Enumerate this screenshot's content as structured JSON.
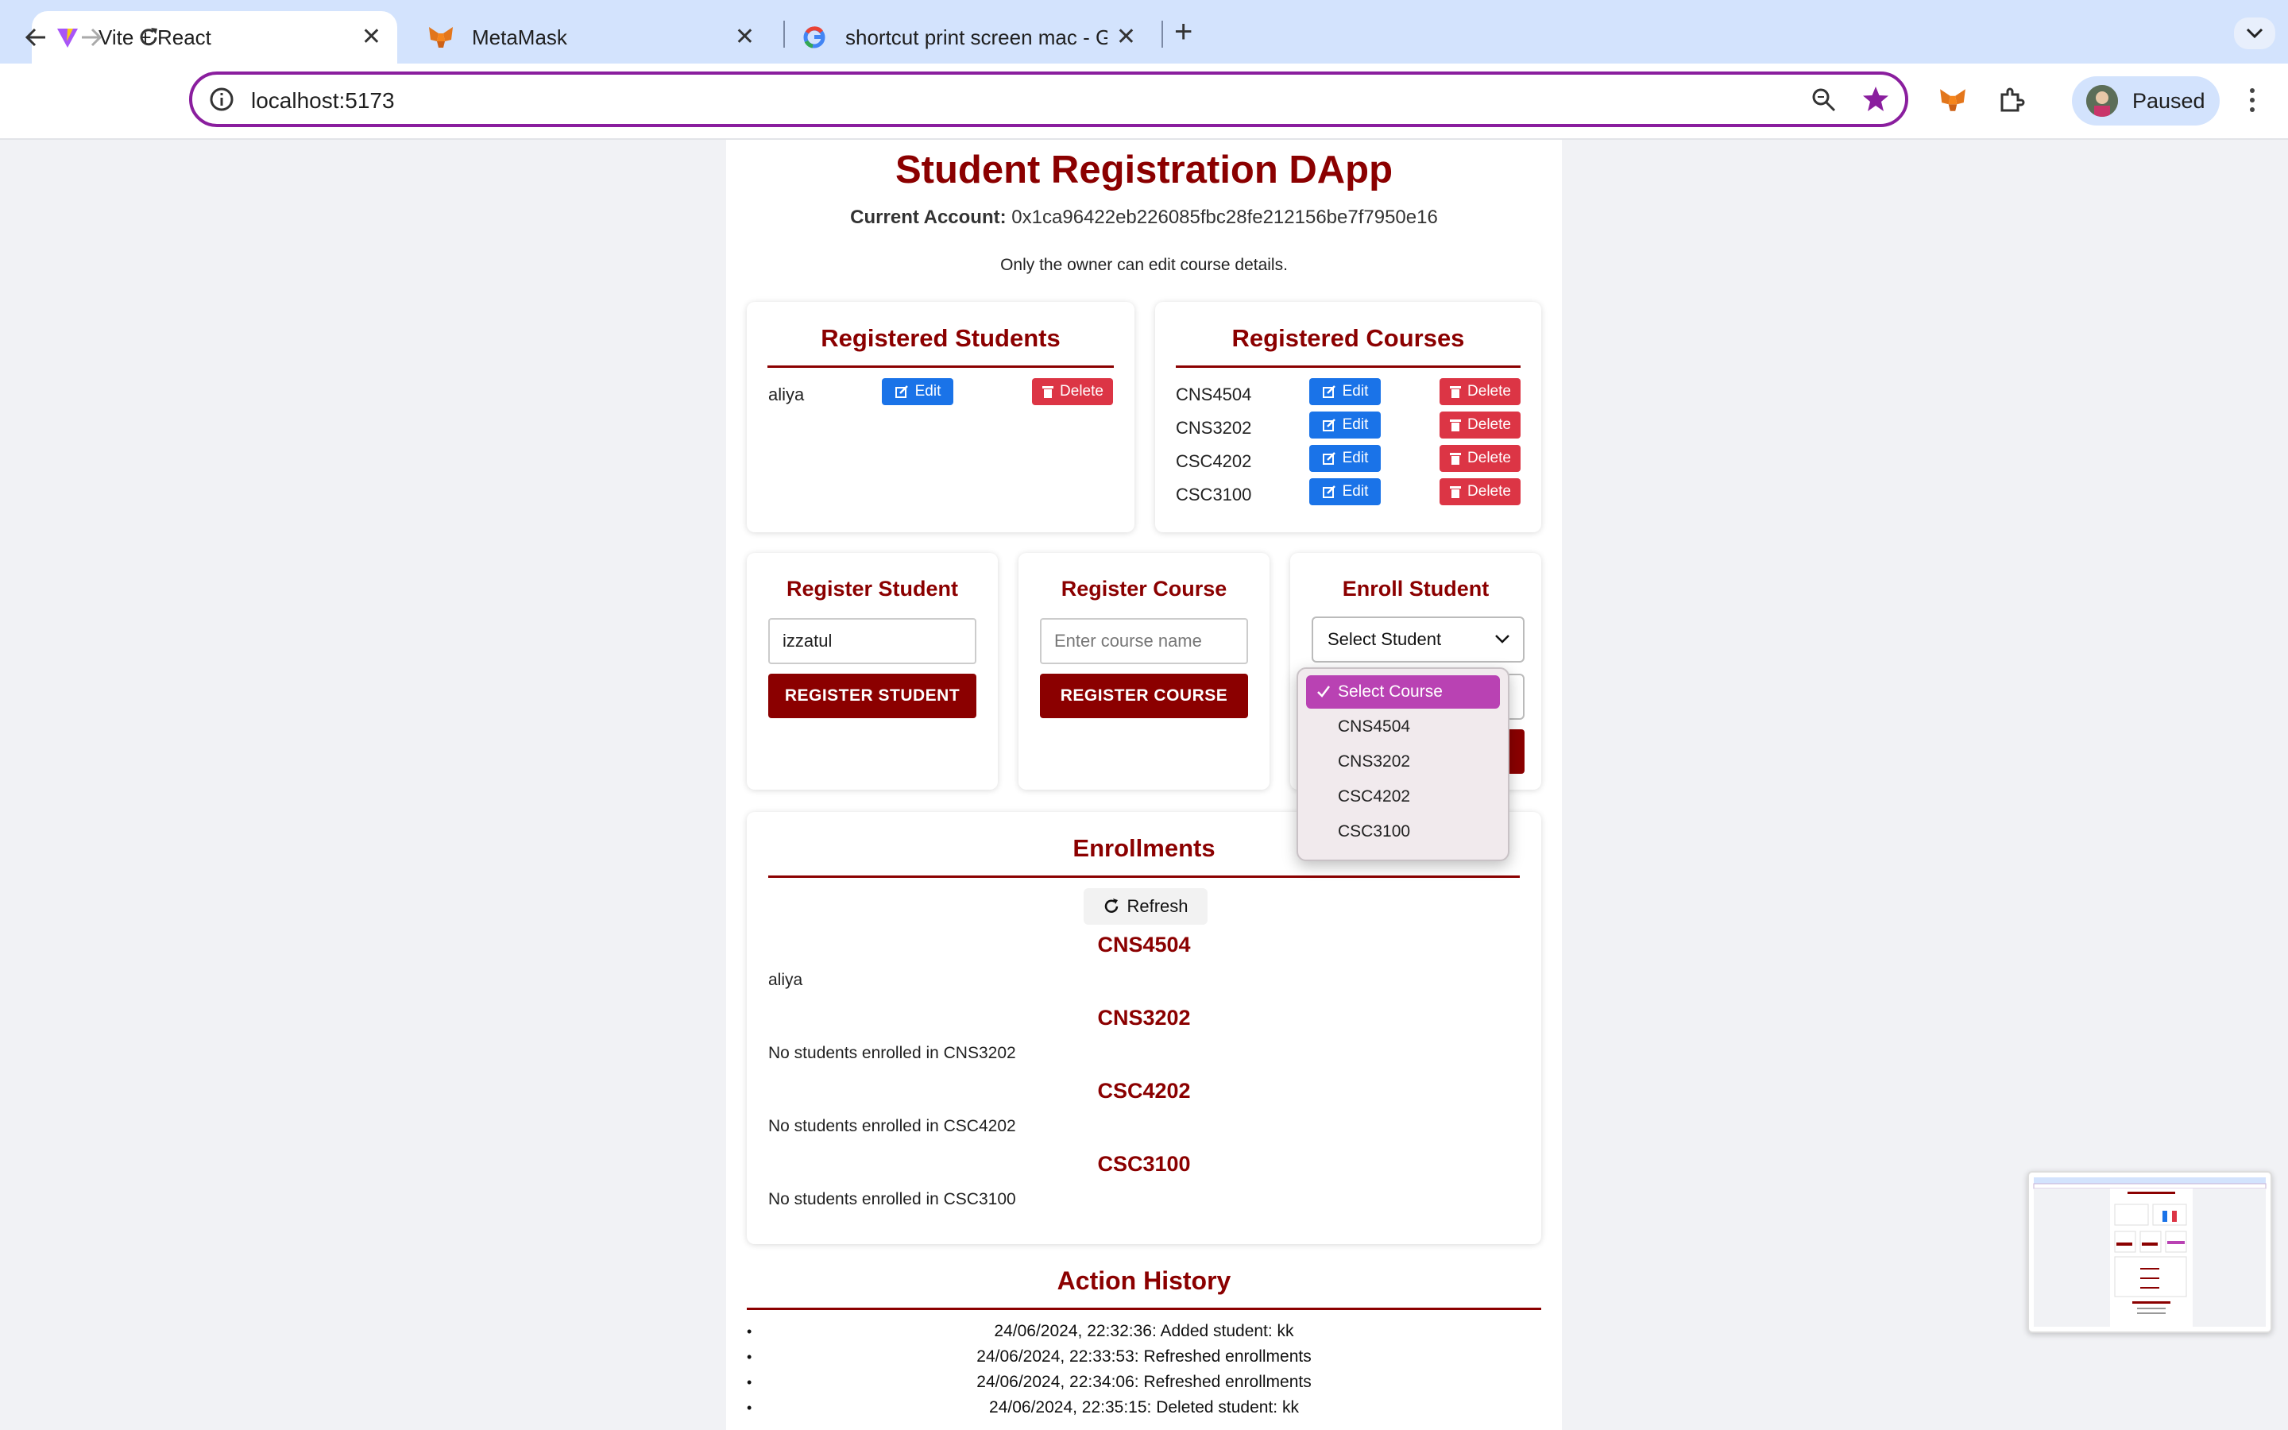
{
  "browser": {
    "tabs": [
      {
        "title": "Vite + React",
        "icon": "vite-icon",
        "active": true
      },
      {
        "title": "MetaMask",
        "icon": "metamask-fox-icon",
        "active": false
      },
      {
        "title": "shortcut print screen mac - G",
        "icon": "google-g-icon",
        "active": false
      }
    ],
    "url": "localhost:5173",
    "profile_label": "Paused"
  },
  "app": {
    "title": "Student Registration DApp",
    "account_label": "Current Account:",
    "account_value": "0x1ca96422eb226085fbc28fe212156be7f7950e16",
    "owner_note": "Only the owner can edit course details."
  },
  "registered_students": {
    "title": "Registered Students",
    "items": [
      {
        "name": "aliya"
      }
    ],
    "edit_label": "Edit",
    "delete_label": "Delete"
  },
  "registered_courses": {
    "title": "Registered Courses",
    "items": [
      {
        "name": "CNS4504"
      },
      {
        "name": "CNS3202"
      },
      {
        "name": "CSC4202"
      },
      {
        "name": "CSC3100"
      }
    ],
    "edit_label": "Edit",
    "delete_label": "Delete"
  },
  "register_student": {
    "title": "Register Student",
    "input_value": "izzatul",
    "button_label": "REGISTER STUDENT"
  },
  "register_course": {
    "title": "Register Course",
    "input_placeholder": "Enter course name",
    "button_label": "REGISTER COURSE"
  },
  "enroll_student": {
    "title": "Enroll Student",
    "student_select": "Select Student",
    "course_options": [
      "Select Course",
      "CNS4504",
      "CNS3202",
      "CSC4202",
      "CSC3100"
    ],
    "selected_course": "Select Course"
  },
  "enrollments": {
    "title": "Enrollments",
    "refresh_label": "Refresh",
    "courses": [
      {
        "code": "CNS4504",
        "line": "aliya"
      },
      {
        "code": "CNS3202",
        "line": "No students enrolled in CNS3202"
      },
      {
        "code": "CSC4202",
        "line": "No students enrolled in CSC4202"
      },
      {
        "code": "CSC3100",
        "line": "No students enrolled in CSC3100"
      }
    ]
  },
  "action_history": {
    "title": "Action History",
    "items": [
      "24/06/2024, 22:32:36: Added student: kk",
      "24/06/2024, 22:33:53: Refreshed enrollments",
      "24/06/2024, 22:34:06: Refreshed enrollments",
      "24/06/2024, 22:35:15: Deleted student: kk"
    ]
  },
  "colors": {
    "accent": "#8b0000",
    "edit_button": "#1a73e8",
    "delete_button": "#dc3545",
    "dropdown_selected": "#b942b3",
    "omnibox_border": "#8a1e9e"
  }
}
